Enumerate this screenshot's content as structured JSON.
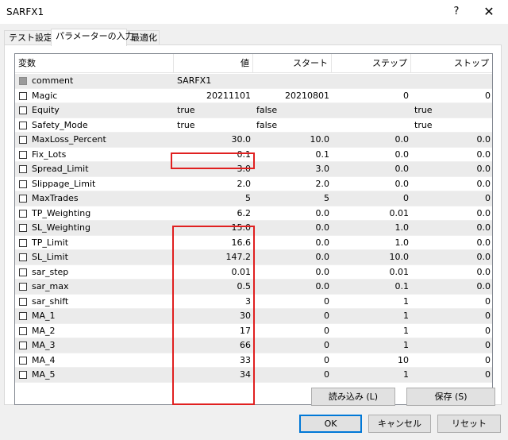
{
  "window": {
    "title": "SARFX1",
    "help": "?",
    "close": "✕"
  },
  "tabs": [
    {
      "label": "テスト設定"
    },
    {
      "label": "パラメーターの入力"
    },
    {
      "label": "最適化"
    }
  ],
  "grid": {
    "headers": {
      "name": "変数",
      "value": "値",
      "start": "スタート",
      "step": "ステップ",
      "stop": "ストップ"
    },
    "rows": [
      {
        "name": "comment",
        "value": "SARFX1",
        "start": "",
        "step": "",
        "stop": ""
      },
      {
        "name": "Magic",
        "value": "20211101",
        "start": "20210801",
        "step": "0",
        "stop": "0"
      },
      {
        "name": "Equity",
        "value": "true",
        "start": "false",
        "step": "",
        "stop": "true"
      },
      {
        "name": "Safety_Mode",
        "value": "true",
        "start": "false",
        "step": "",
        "stop": "true"
      },
      {
        "name": "MaxLoss_Percent",
        "value": "30.0",
        "start": "10.0",
        "step": "0.0",
        "stop": "0.0"
      },
      {
        "name": "Fix_Lots",
        "value": "0.1",
        "start": "0.1",
        "step": "0.0",
        "stop": "0.0"
      },
      {
        "name": "Spread_Limit",
        "value": "3.0",
        "start": "3.0",
        "step": "0.0",
        "stop": "0.0"
      },
      {
        "name": "Slippage_Limit",
        "value": "2.0",
        "start": "2.0",
        "step": "0.0",
        "stop": "0.0"
      },
      {
        "name": "MaxTrades",
        "value": "5",
        "start": "5",
        "step": "0",
        "stop": "0"
      },
      {
        "name": "TP_Weighting",
        "value": "6.2",
        "start": "0.0",
        "step": "0.01",
        "stop": "0.0"
      },
      {
        "name": "SL_Weighting",
        "value": "15.0",
        "start": "0.0",
        "step": "1.0",
        "stop": "0.0"
      },
      {
        "name": "TP_Limit",
        "value": "16.6",
        "start": "0.0",
        "step": "1.0",
        "stop": "0.0"
      },
      {
        "name": "SL_Limit",
        "value": "147.2",
        "start": "0.0",
        "step": "10.0",
        "stop": "0.0"
      },
      {
        "name": "sar_step",
        "value": "0.01",
        "start": "0.0",
        "step": "0.01",
        "stop": "0.0"
      },
      {
        "name": "sar_max",
        "value": "0.5",
        "start": "0.0",
        "step": "0.1",
        "stop": "0.0"
      },
      {
        "name": "sar_shift",
        "value": "3",
        "start": "0",
        "step": "1",
        "stop": "0"
      },
      {
        "name": "MA_1",
        "value": "30",
        "start": "0",
        "step": "1",
        "stop": "0"
      },
      {
        "name": "MA_2",
        "value": "17",
        "start": "0",
        "step": "1",
        "stop": "0"
      },
      {
        "name": "MA_3",
        "value": "66",
        "start": "0",
        "step": "1",
        "stop": "0"
      },
      {
        "name": "MA_4",
        "value": "33",
        "start": "0",
        "step": "10",
        "stop": "0"
      },
      {
        "name": "MA_5",
        "value": "34",
        "start": "0",
        "step": "1",
        "stop": "0"
      }
    ]
  },
  "buttons": {
    "load": "読み込み (L)",
    "save": "保存 (S)",
    "ok": "OK",
    "cancel": "キャンセル",
    "reset": "リセット"
  }
}
